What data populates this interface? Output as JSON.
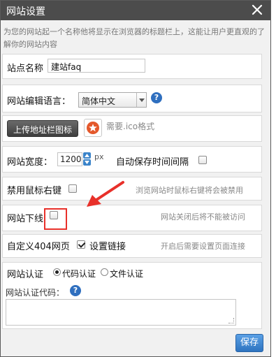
{
  "dialog": {
    "title": "网站设置",
    "close_icon": "close-x-icon"
  },
  "description": "为您的网站起一个名称他将显示在浏览器的标题栏上，这能让用户更直观的了解你的网站内容",
  "site_name": {
    "label": "站点名称",
    "value": "建站faq"
  },
  "language": {
    "label": "网站编辑语言：",
    "selected": "简体中文",
    "help": "?"
  },
  "favicon": {
    "button": "上传地址栏图标",
    "hint": "需要.ico格式",
    "icon": "star-icon"
  },
  "width": {
    "label": "网站宽度：",
    "value": "1200",
    "unit": "px",
    "autosave_label": "自动保存时间间隔",
    "autosave_checked": false
  },
  "disable_right_click": {
    "label": "禁用鼠标右键",
    "checked": false,
    "hint": "浏览网站时鼠标右键将会被禁用"
  },
  "site_offline": {
    "label": "网站下线",
    "checked": false,
    "hint": "网站关闭后将不能被访问"
  },
  "custom_404": {
    "label": "自定义404网页",
    "checked": true,
    "link": "设置链接",
    "hint": "开启后需要设置页面连接"
  },
  "verification": {
    "label": "网站认证",
    "options": [
      "代码认证",
      "文件认证"
    ],
    "selected": "代码认证",
    "code_label": "网站认证代码：",
    "help": "?"
  },
  "save_button": "保存",
  "colors": {
    "title_bar": "#4c4c4c",
    "accent_blue": "#2e74c0",
    "annotation_red": "#e8302a",
    "icon_orange": "#e4582b"
  }
}
